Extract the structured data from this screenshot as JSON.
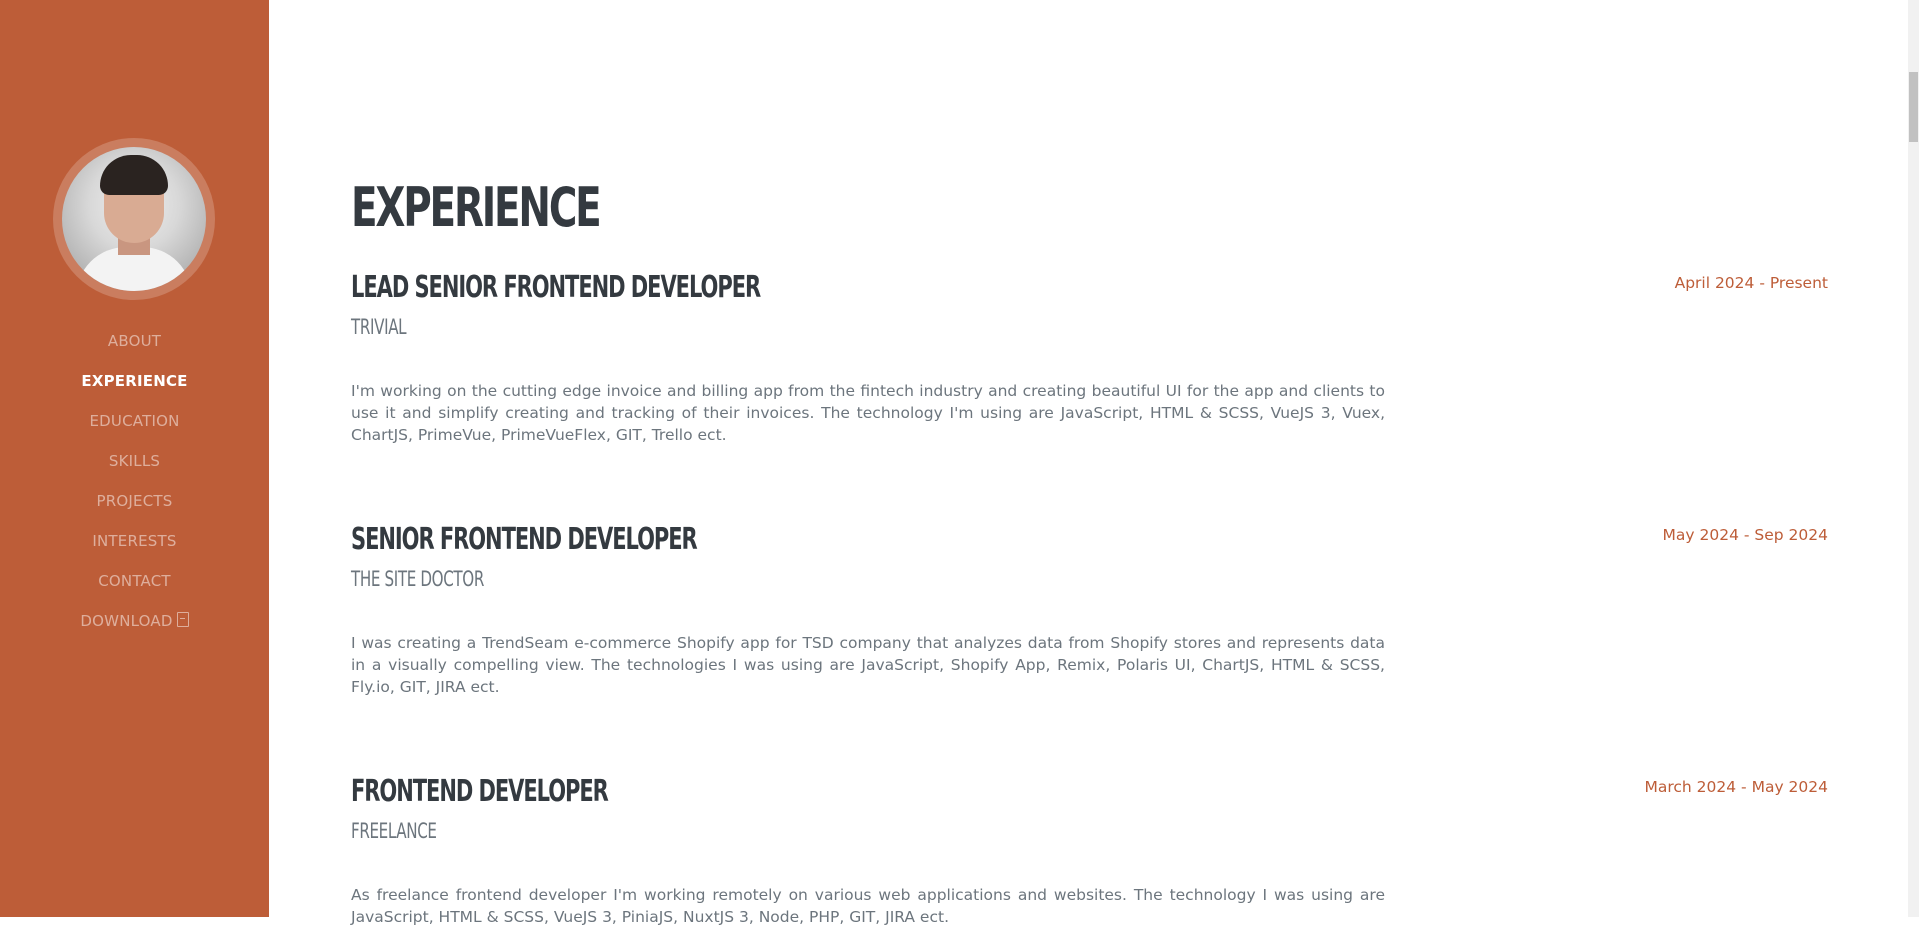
{
  "nav": {
    "items": [
      {
        "label": "ABOUT"
      },
      {
        "label": "EXPERIENCE"
      },
      {
        "label": "EDUCATION"
      },
      {
        "label": "SKILLS"
      },
      {
        "label": "PROJECTS"
      },
      {
        "label": "INTERESTS"
      },
      {
        "label": "CONTACT"
      },
      {
        "label": "DOWNLOAD"
      }
    ],
    "active": "EXPERIENCE",
    "download_icon": "pdf-file-icon"
  },
  "section": {
    "title": "EXPERIENCE"
  },
  "jobs": [
    {
      "title": "LEAD SENIOR FRONTEND DEVELOPER",
      "company": "TRIVIAL",
      "date": "April 2024 - Present",
      "description": "I'm working on the cutting edge invoice and billing app from the fintech industry and creating beautiful UI for the app and clients to use it and simplify creating and tracking of their invoices. The technology I'm using are JavaScript, HTML & SCSS, VueJS 3, Vuex, ChartJS, PrimeVue, PrimeVueFlex, GIT, Trello ect."
    },
    {
      "title": "SENIOR FRONTEND DEVELOPER",
      "company": "THE SITE DOCTOR",
      "date": "May 2024 - Sep 2024",
      "description": "I was creating a TrendSeam e-commerce Shopify app for TSD company that analyzes data from Shopify stores and represents data in a visually compelling view. The technologies I was using are JavaScript, Shopify App, Remix, Polaris UI, ChartJS, HTML & SCSS, Fly.io, GIT, JIRA ect."
    },
    {
      "title": "FRONTEND DEVELOPER",
      "company": "FREELANCE",
      "date": "March 2024 - May 2024",
      "description": "As freelance frontend developer I'm working remotely on various web applications and websites. The technology I was using are JavaScript, HTML & SCSS, VueJS 3, PiniaJS, NuxtJS 3, Node, PHP, GIT, JIRA ect."
    }
  ],
  "colors": {
    "brand": "#bd5d38",
    "heading": "#343a40",
    "muted": "#6c757d"
  }
}
